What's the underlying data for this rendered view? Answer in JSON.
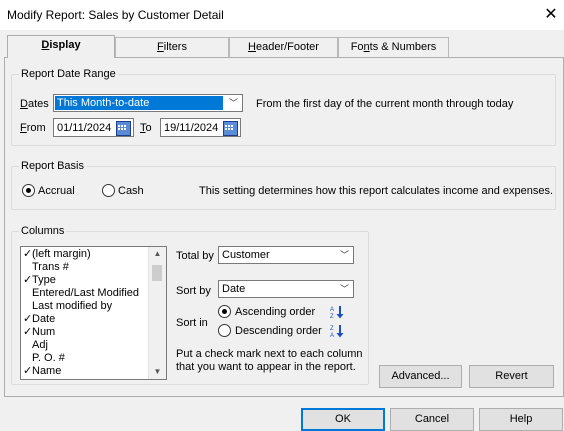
{
  "window": {
    "title": "Modify Report: Sales by Customer Detail"
  },
  "tabs": [
    {
      "label": "Display",
      "key": "D",
      "active": true
    },
    {
      "label": "Filters",
      "key": "F"
    },
    {
      "label": "Header/Footer",
      "key": "H"
    },
    {
      "label": "Fonts & Numbers",
      "key": "n"
    }
  ],
  "date_range": {
    "legend": "Report Date Range",
    "dates_label": "Dates",
    "dates_value": "This Month-to-date",
    "description": "From the first day of the current month through today",
    "from_label": "From",
    "from_value": "01/11/2024",
    "to_label": "To",
    "to_value": "19/11/2024"
  },
  "basis": {
    "legend": "Report Basis",
    "accrual_label": "Accrual",
    "cash_label": "Cash",
    "selected": "accrual",
    "description": "This setting determines how this report calculates income and expenses."
  },
  "columns": {
    "legend": "Columns",
    "items": [
      {
        "label": "(left margin)",
        "checked": true
      },
      {
        "label": "Trans #",
        "checked": false
      },
      {
        "label": "Type",
        "checked": true
      },
      {
        "label": "Entered/Last Modified",
        "checked": false
      },
      {
        "label": "Last modified by",
        "checked": false
      },
      {
        "label": "Date",
        "checked": true
      },
      {
        "label": "Num",
        "checked": true
      },
      {
        "label": "Adj",
        "checked": false
      },
      {
        "label": "P. O. #",
        "checked": false
      },
      {
        "label": "Name",
        "checked": true
      }
    ],
    "check_glyph": "✓",
    "total_by_label": "Total by",
    "total_by_value": "Customer",
    "sort_by_label": "Sort by",
    "sort_by_value": "Date",
    "sort_in_label": "Sort in",
    "ascending_label": "Ascending order",
    "descending_label": "Descending order",
    "sort_selected": "ascending",
    "hint": "Put a check mark next to each column that you want to appear in the report."
  },
  "buttons": {
    "advanced": "Advanced...",
    "revert": "Revert",
    "ok": "OK",
    "cancel": "Cancel",
    "help": "Help"
  },
  "colors": {
    "selection": "#0078d7",
    "calendar": "#5b8bd6",
    "sort_arrow": "#1f4fbf"
  }
}
